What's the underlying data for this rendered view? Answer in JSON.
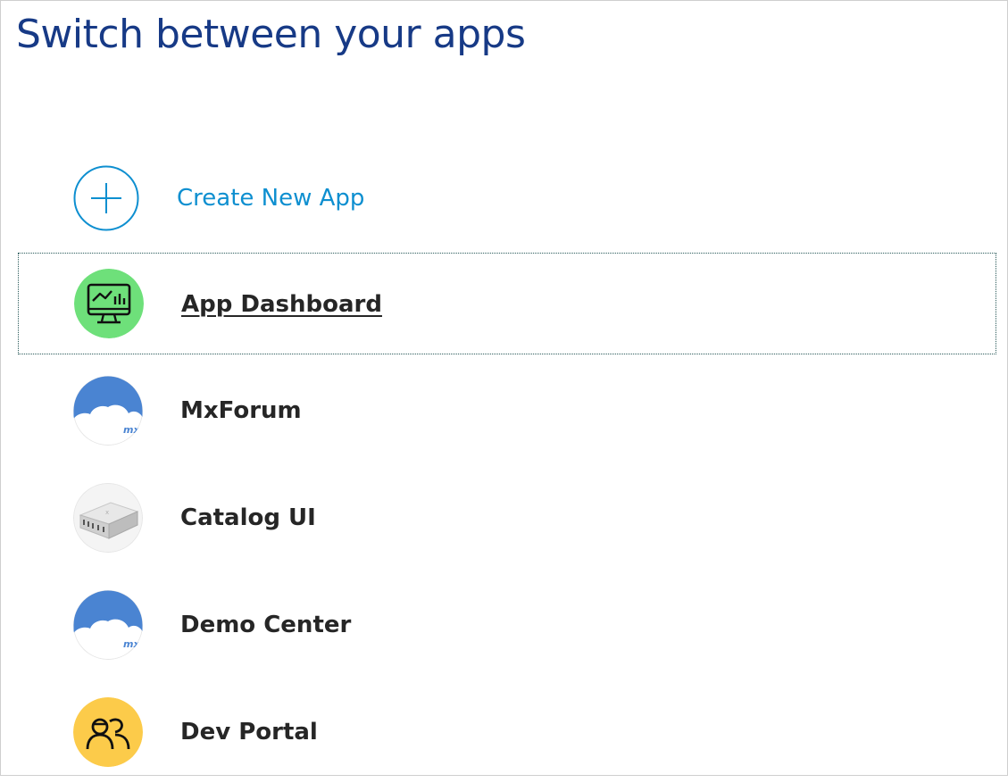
{
  "page": {
    "title": "Switch between your apps"
  },
  "create_app": {
    "label": "Create New App",
    "icon": "plus-circle-icon"
  },
  "apps": [
    {
      "label": "App Dashboard",
      "icon": "monitor-chart-icon",
      "icon_bg": "#6ee07a",
      "selected": true
    },
    {
      "label": "MxForum",
      "icon": "mx-cloud-icon",
      "icon_bg": "#4a84d2",
      "icon_text": "mx"
    },
    {
      "label": "Catalog UI",
      "icon": "usb-hub-icon",
      "icon_bg": "#f4f4f4"
    },
    {
      "label": "Demo Center",
      "icon": "mx-cloud-icon",
      "icon_bg": "#4a84d2",
      "icon_text": "mx"
    },
    {
      "label": "Dev Portal",
      "icon": "people-icon",
      "icon_bg": "#fccb4a"
    }
  ],
  "colors": {
    "title": "#173a86",
    "link": "#0e8fd0",
    "selection_border": "#2b5b5b"
  }
}
